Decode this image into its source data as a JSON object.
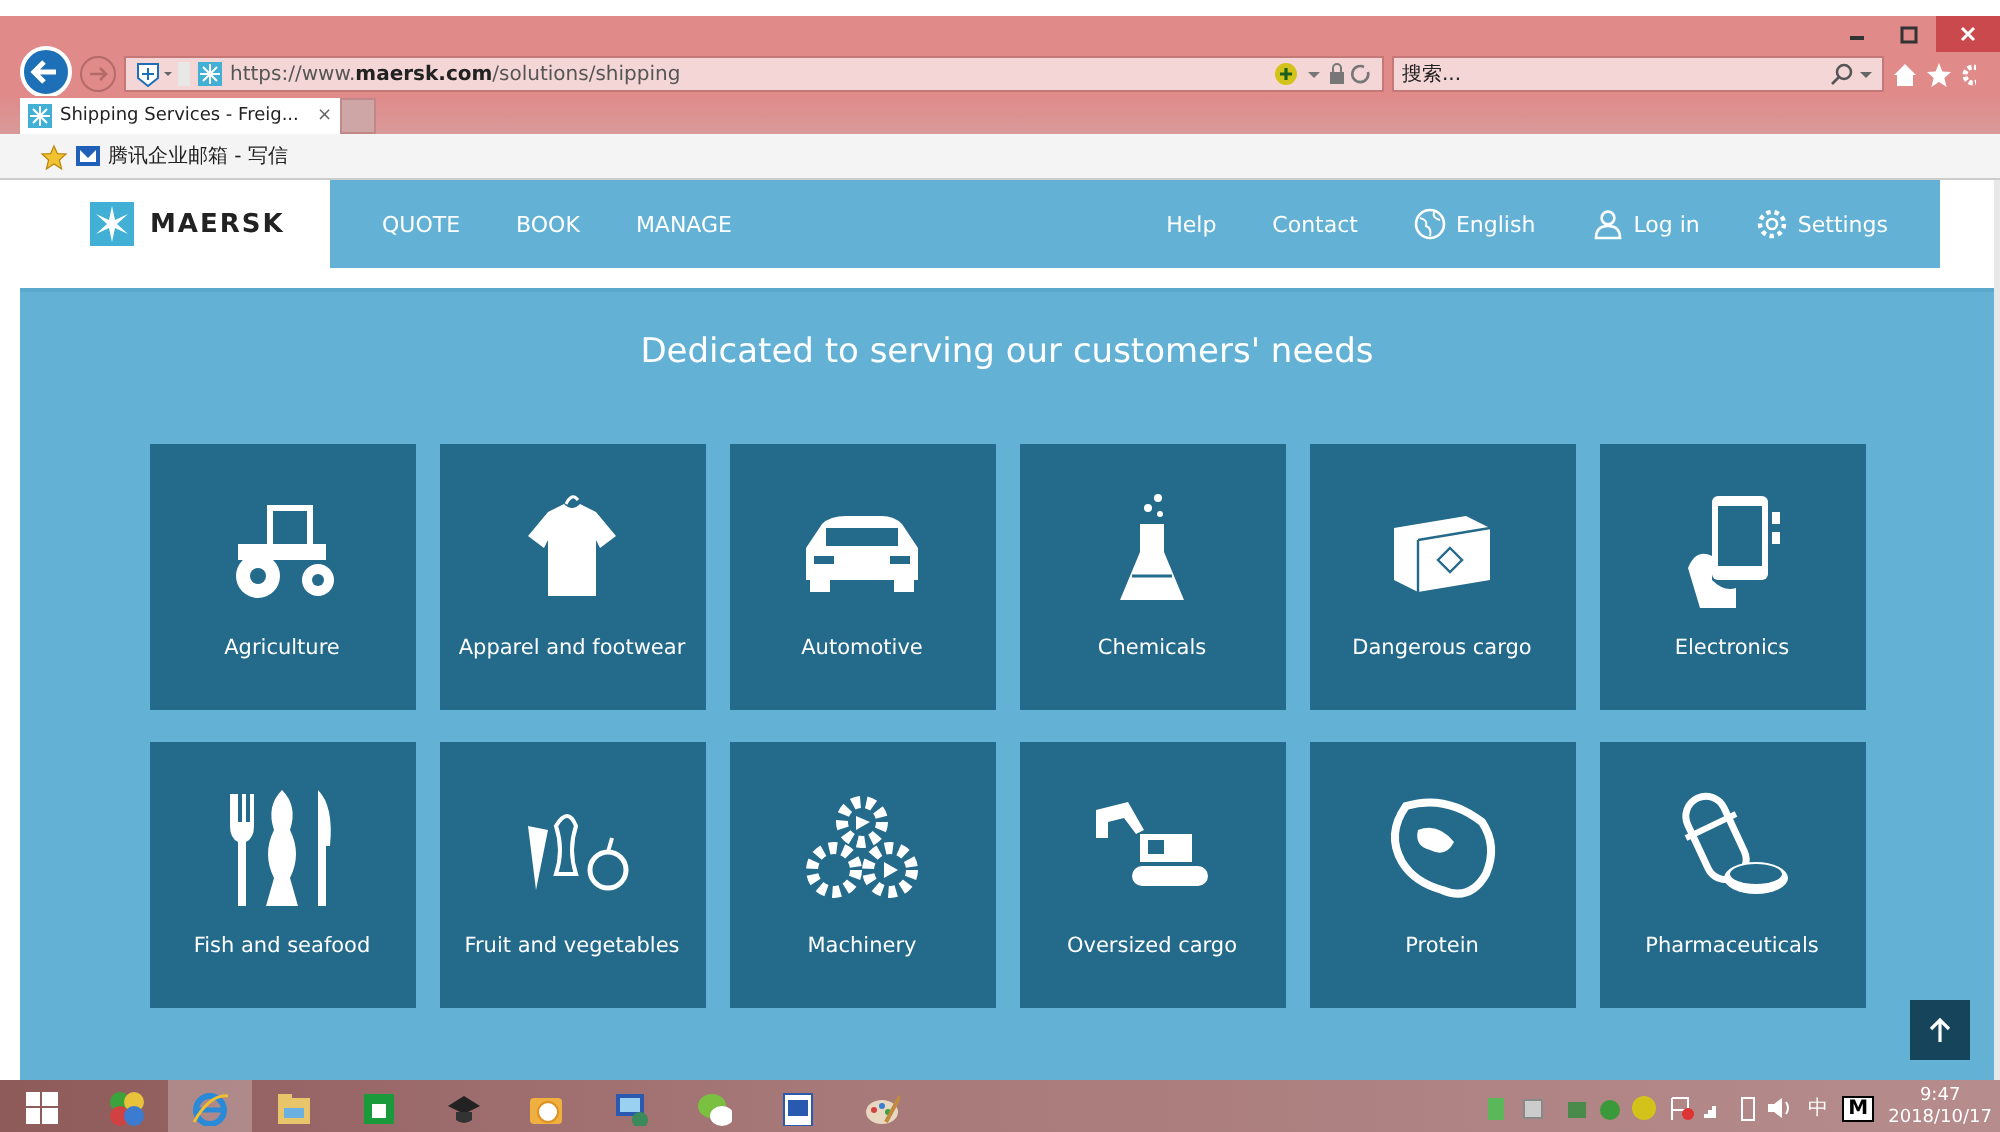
{
  "browser": {
    "address": "https://www.**maersk.com**/solutions/shipping",
    "search": {
      "placeholder": "搜索..."
    },
    "tabs": [
      {
        "label": "Shipping Services - Freig...",
        "selected": true,
        "close": "×"
      }
    ],
    "favorites": [
      {
        "label": "腾讯企业邮箱 - 写信"
      }
    ]
  },
  "page": {
    "brand": "MAERSK",
    "nav_left": [
      "QUOTE",
      "BOOK",
      "MANAGE"
    ],
    "nav_right": [
      {
        "label": "Help",
        "kind": "text"
      },
      {
        "label": "Contact",
        "kind": "text"
      },
      {
        "label": "English",
        "kind": "globe"
      },
      {
        "label": "Log in",
        "kind": "user"
      },
      {
        "label": "Settings",
        "kind": "gear"
      }
    ],
    "headline": "Dedicated to serving our customers' needs",
    "categories": [
      {
        "label": "Agriculture"
      },
      {
        "label": "Apparel and footwear"
      },
      {
        "label": "Automotive"
      },
      {
        "label": "Chemicals"
      },
      {
        "label": "Dangerous cargo"
      },
      {
        "label": "Electronics"
      },
      {
        "label": "Fish and seafood"
      },
      {
        "label": "Fruit and vegetables"
      },
      {
        "label": "Machinery"
      },
      {
        "label": "Oversized cargo"
      },
      {
        "label": "Protein"
      },
      {
        "label": "Pharmaceuticals"
      }
    ]
  },
  "taskbar": {
    "apps": [
      {
        "selected": false
      },
      {
        "selected": true
      },
      {
        "selected": false
      },
      {
        "selected": false
      },
      {
        "selected": false
      },
      {
        "selected": false
      },
      {
        "selected": false
      },
      {
        "selected": false
      },
      {
        "selected": false
      },
      {
        "selected": false
      }
    ],
    "ime": "中",
    "ime_mode": "M",
    "time": "9:47",
    "date": "2018/10/17"
  }
}
